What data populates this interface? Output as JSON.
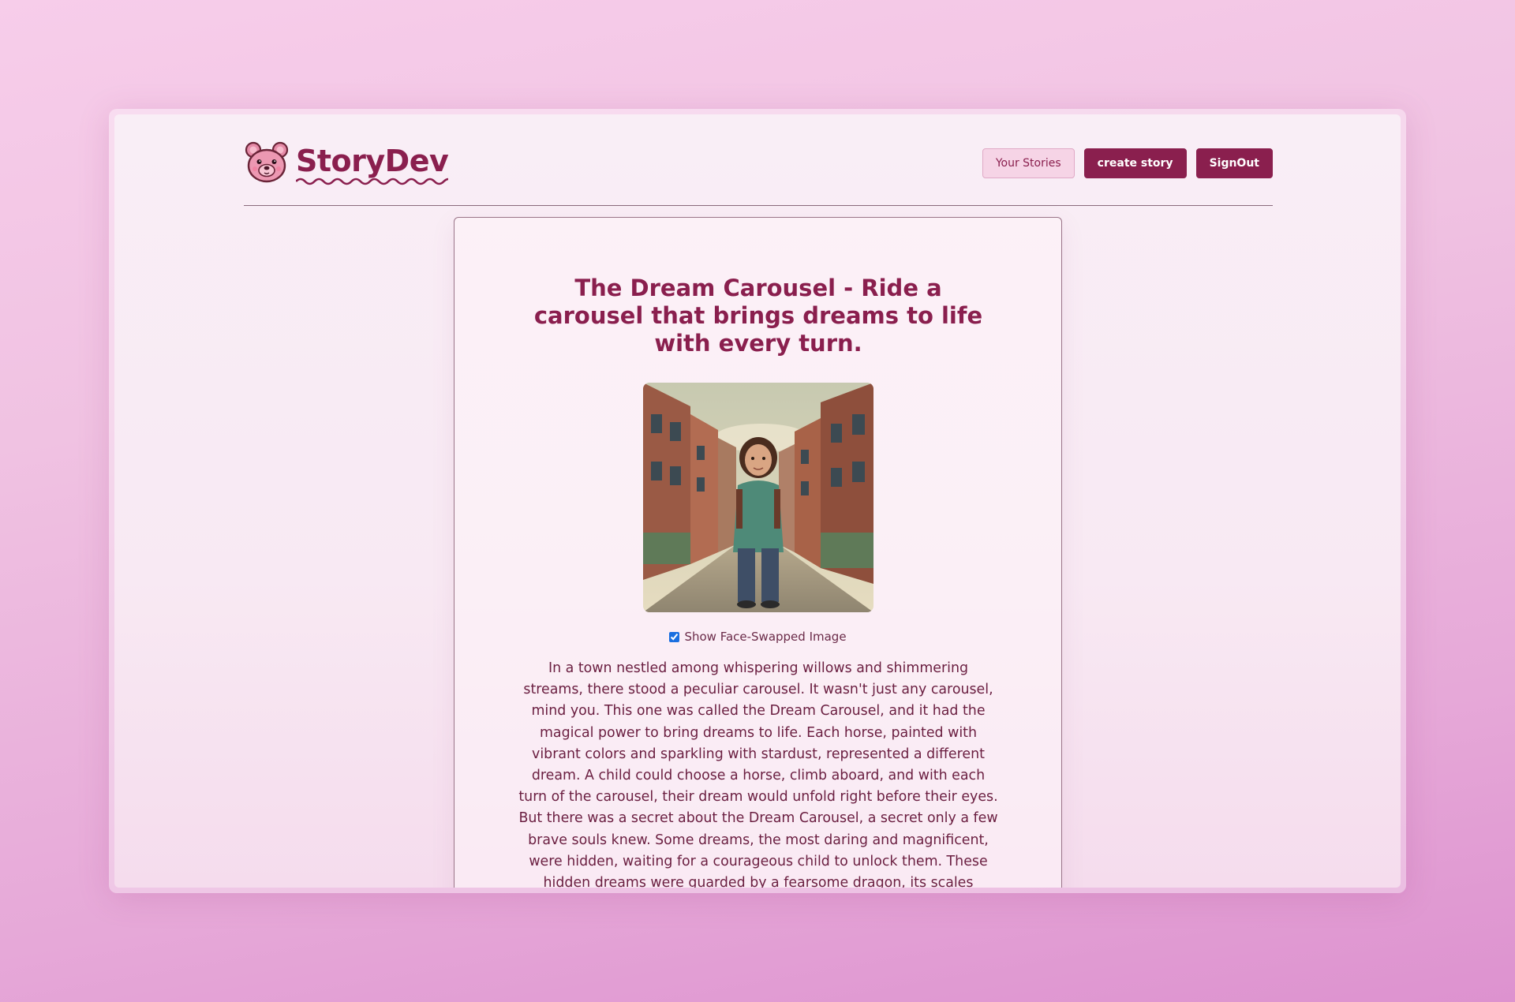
{
  "brand": {
    "name": "StoryDev",
    "logo_icon": "teddy-bear-icon"
  },
  "nav": {
    "your_stories": "Your Stories",
    "create_story": "create story",
    "sign_out": "SignOut"
  },
  "story": {
    "title": "The Dream Carousel - Ride a carousel that brings dreams to life with every turn.",
    "image_icon": "illustration-girl-walking-city-street",
    "toggle_label": "Show Face-Swapped Image",
    "toggle_checked": true,
    "body": "In a town nestled among whispering willows and shimmering streams, there stood a peculiar carousel. It wasn't just any carousel, mind you. This one was called the Dream Carousel, and it had the magical power to bring dreams to life. Each horse, painted with vibrant colors and sparkling with stardust, represented a different dream. A child could choose a horse, climb aboard, and with each turn of the carousel, their dream would unfold right before their eyes. But there was a secret about the Dream Carousel, a secret only a few brave souls knew. Some dreams, the most daring and magnificent, were hidden, waiting for a courageous child to unlock them. These hidden dreams were guarded by a fearsome dragon, its scales"
  },
  "colors": {
    "accent": "#8a1f4e",
    "accent_light": "#f6d4e6",
    "text": "#6a1e40",
    "checkbox": "#1a6fe0"
  }
}
